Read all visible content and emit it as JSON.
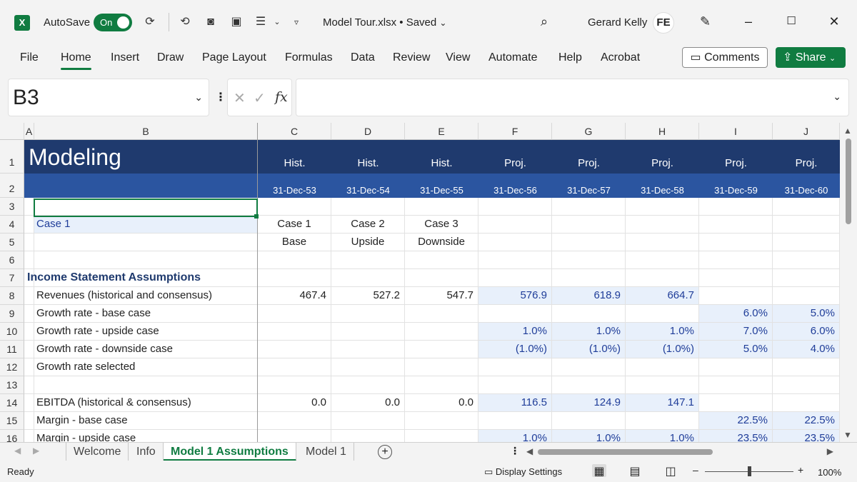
{
  "titlebar": {
    "app_logo": "X",
    "autosave_label": "AutoSave",
    "autosave_state": "On",
    "doc_title": "Model Tour.xlsx • Saved",
    "user_name": "Gerard Kelly",
    "user_initials": "FE"
  },
  "ribbon": {
    "tabs": [
      "File",
      "Home",
      "Insert",
      "Draw",
      "Page Layout",
      "Formulas",
      "Data",
      "Review",
      "View",
      "Automate",
      "Help",
      "Acrobat"
    ],
    "active_tab": "Home",
    "comments_label": "Comments",
    "share_label": "Share"
  },
  "formula_bar": {
    "name_box": "B3",
    "fx_label": "fx",
    "formula": ""
  },
  "grid": {
    "columns": [
      "A",
      "B",
      "C",
      "D",
      "E",
      "F",
      "G",
      "H",
      "I",
      "J"
    ],
    "rows": [
      "1",
      "2",
      "3",
      "4",
      "5",
      "6",
      "7",
      "8",
      "9",
      "10",
      "11",
      "12",
      "13",
      "14",
      "15",
      "16"
    ],
    "title": "Modeling",
    "period_types": [
      "Hist.",
      "Hist.",
      "Hist.",
      "Proj.",
      "Proj.",
      "Proj.",
      "Proj.",
      "Proj."
    ],
    "period_dates": [
      "31-Dec-53",
      "31-Dec-54",
      "31-Dec-55",
      "31-Dec-56",
      "31-Dec-57",
      "31-Dec-58",
      "31-Dec-59",
      "31-Dec-60"
    ],
    "case_selector": "Case  1",
    "case_names": [
      "Case  1",
      "Case  2",
      "Case  3"
    ],
    "case_desc": [
      "Base",
      "Upside",
      "Downside"
    ],
    "section_header": "Income Statement Assumptions",
    "labels": {
      "r8": "Revenues (historical and consensus)",
      "r9": "Growth rate - base case",
      "r10": "Growth rate - upside case",
      "r11": "Growth rate - downside case",
      "r12": "Growth rate selected",
      "r14": "EBITDA (historical & consensus)",
      "r15": "Margin - base case",
      "r16": "Margin - upside case"
    },
    "values": {
      "r8": [
        "467.4",
        "527.2",
        "547.7",
        "576.9",
        "618.9",
        "664.7",
        "",
        ""
      ],
      "r9": [
        "",
        "",
        "",
        "",
        "",
        "",
        "6.0%",
        "5.0%"
      ],
      "r10": [
        "",
        "",
        "",
        "1.0%",
        "1.0%",
        "1.0%",
        "7.0%",
        "6.0%"
      ],
      "r11": [
        "",
        "",
        "",
        "(1.0%)",
        "(1.0%)",
        "(1.0%)",
        "5.0%",
        "4.0%"
      ],
      "r14": [
        "0.0",
        "0.0",
        "0.0",
        "116.5",
        "124.9",
        "147.1",
        "",
        ""
      ],
      "r15": [
        "",
        "",
        "",
        "",
        "",
        "",
        "22.5%",
        "22.5%"
      ],
      "r16": [
        "",
        "",
        "",
        "1.0%",
        "1.0%",
        "1.0%",
        "23.5%",
        "23.5%"
      ]
    }
  },
  "sheets": {
    "tabs": [
      "Welcome",
      "Info",
      "Model 1 Assumptions",
      "Model 1"
    ],
    "active": "Model 1 Assumptions"
  },
  "status": {
    "ready": "Ready",
    "display_settings": "Display Settings",
    "zoom": "100%"
  }
}
